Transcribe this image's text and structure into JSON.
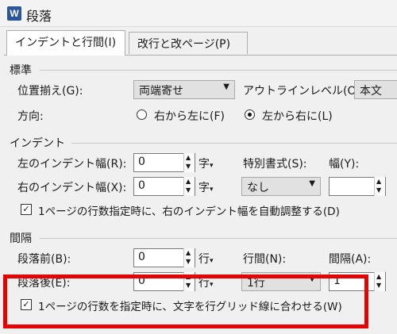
{
  "window": {
    "title": "段落",
    "app_icon_letter": "W"
  },
  "tabs": [
    {
      "label": "インデントと行間(I)",
      "active": true
    },
    {
      "label": "改行と改ページ(P)",
      "active": false
    }
  ],
  "general": {
    "title": "標準",
    "alignment_label": "位置揃え(G):",
    "alignment_value": "両端寄せ",
    "outline_label": "アウトラインレベル(O):",
    "outline_value": "本文",
    "direction_label": "方向:",
    "rtl_label": "右から左に(F)",
    "ltr_label": "左から右に(L)",
    "ltr_checked": true
  },
  "indent": {
    "title": "インデント",
    "left_label": "左のインデント幅(R):",
    "left_value": "0",
    "left_unit": "字",
    "right_label": "右のインデント幅(X):",
    "right_value": "0",
    "right_unit": "字",
    "special_label": "特別書式(S):",
    "special_value": "なし",
    "width_label": "幅(Y):",
    "width_value": "",
    "auto_adjust_label": "1ページの行数指定時に、右のインデント幅を自動調整する(D)",
    "auto_adjust_checked": true
  },
  "spacing": {
    "title": "間隔",
    "before_label": "段落前(B):",
    "before_value": "0",
    "before_unit": "行",
    "after_label": "段落後(E):",
    "after_value": "0",
    "after_unit": "行",
    "line_spacing_label": "行間(N):",
    "line_spacing_value": "1行",
    "at_label": "間隔(A):",
    "at_value": "1",
    "snap_label": "1ページの行数を指定時に、文字を行グリッド線に合わせる(W)",
    "snap_checked": true
  },
  "highlight_color": "#e60000"
}
